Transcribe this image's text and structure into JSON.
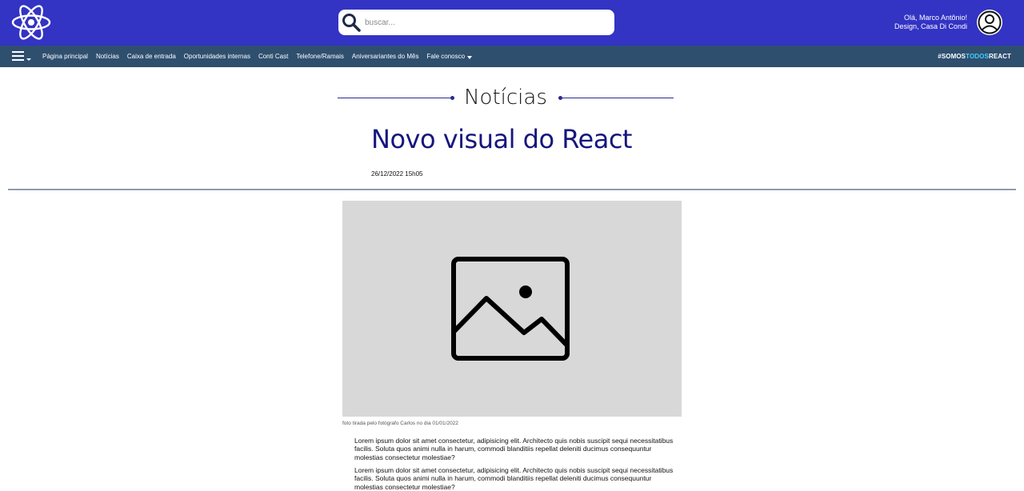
{
  "header": {
    "logo_icon": "react-atom-icon",
    "search": {
      "placeholder": "buscar...",
      "value": "",
      "icon": "search-icon"
    },
    "user": {
      "greeting": "Olá, Marco Antônio!",
      "subtitle": "Design, Casa Di Condi",
      "avatar_icon": "user-avatar-icon"
    },
    "bg_color": "#3333c4"
  },
  "nav": {
    "menu_icon": "hamburger-menu-icon",
    "items": [
      {
        "label": "Página principal",
        "dropdown": false
      },
      {
        "label": "Notícias",
        "dropdown": false
      },
      {
        "label": "Caixa de entrada",
        "dropdown": false
      },
      {
        "label": "Oportunidades internas",
        "dropdown": false
      },
      {
        "label": "Conti Cast",
        "dropdown": false
      },
      {
        "label": "Telefone/Ramais",
        "dropdown": false
      },
      {
        "label": "Aniversariantes do Mês",
        "dropdown": false
      },
      {
        "label": "Fale conosco",
        "dropdown": true
      }
    ],
    "hashtag": {
      "part1": "#SOMOS",
      "part2": "TODOS",
      "part3": "REACT"
    },
    "bg_color": "#2f4f6f"
  },
  "article": {
    "section": "Notícias",
    "title": "Novo visual do React",
    "date": "26/12/2022 15h05",
    "image_icon": "image-placeholder-icon",
    "caption": "foto tirada pelo fotógrafo Carlos no dia 01/01/2022",
    "paragraphs": [
      "Lorem ipsum dolor sit amet consectetur, adipisicing elit. Architecto quis nobis suscipit sequi necessitatibus facilis. Soluta quos animi nulla in harum, commodi blanditiis repellat deleniti ducimus consequuntur molestias consectetur molestiae?",
      "Lorem ipsum dolor sit amet consectetur, adipisicing elit. Architecto quis nobis suscipit sequi necessitatibus facilis. Soluta quos animi nulla in harum, commodi blanditiis repellat deleniti ducimus consequuntur molestias consectetur molestiae?"
    ],
    "title_color": "#16167e"
  }
}
